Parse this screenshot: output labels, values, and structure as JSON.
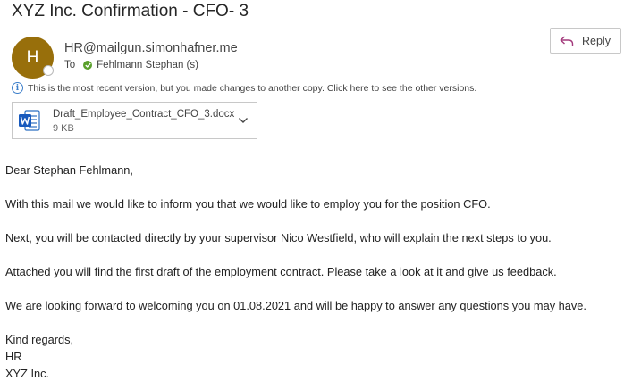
{
  "email": {
    "subject": "XYZ Inc. Confirmation - CFO- 3",
    "sender": {
      "avatar_initial": "H",
      "address": "HR@mailgun.simonhafner.me",
      "avatar_color": "#986f0b"
    },
    "to_label": "To",
    "recipient": "Fehlmann Stephan (s)",
    "reply_label": "Reply",
    "info_message": "This is the most recent version, but you made changes to another copy. Click here to see the other versions.",
    "attachment": {
      "name": "Draft_Employee_Contract_CFO_3.docx",
      "size": "9 KB",
      "icon": "word-icon"
    },
    "body": {
      "greeting": "Dear Stephan Fehlmann,",
      "paragraphs": [
        "With this mail we would like to inform you that we would like to employ you for the position CFO.",
        "Next, you will be contacted directly by your supervisor Nico Westfield, who will explain the next steps to you.",
        "Attached you will find the first draft of the employment contract. Please take a look at it and give us feedback.",
        "We are looking forward to welcoming you on 01.08.2021 and will be happy to answer any questions you may have."
      ],
      "signature": [
        "Kind regards,",
        "HR",
        "XYZ Inc."
      ]
    }
  }
}
